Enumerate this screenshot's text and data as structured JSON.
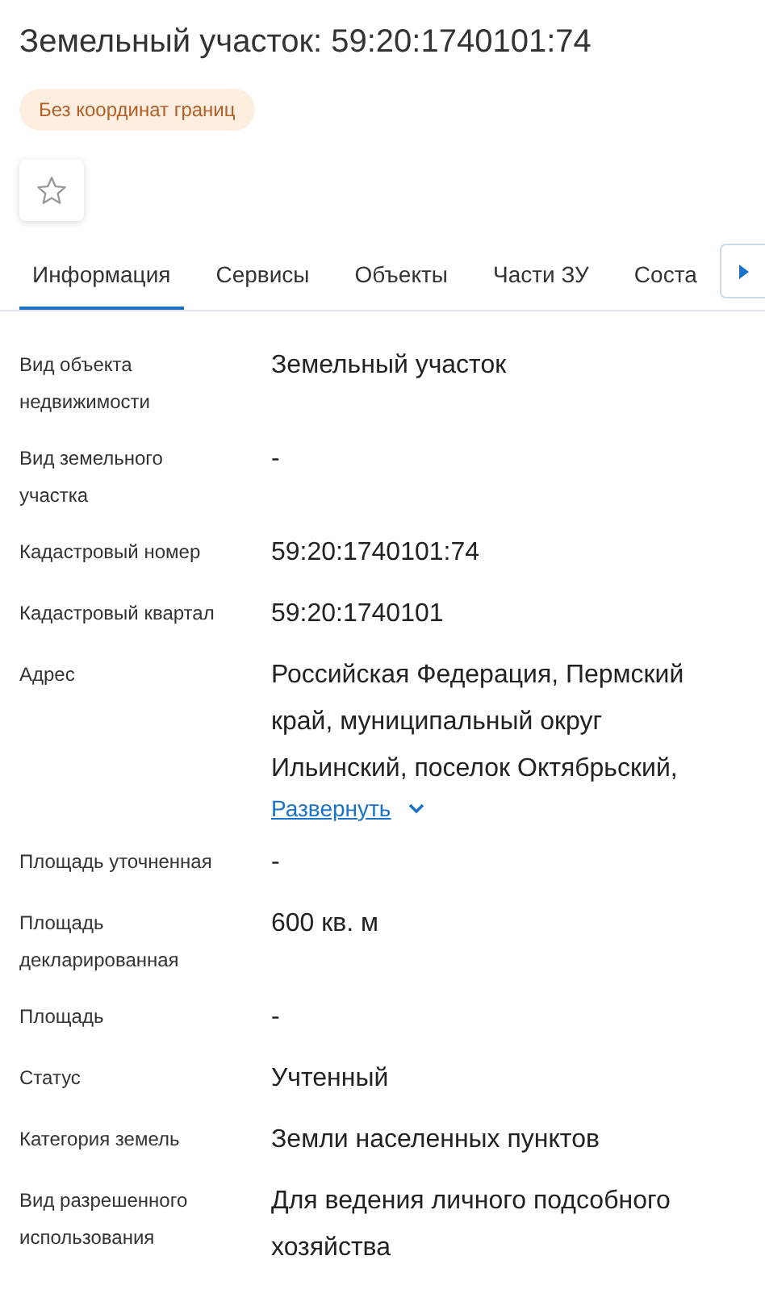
{
  "title": "Земельный участок: 59:20:1740101:74",
  "badge": "Без координат границ",
  "favorite": {
    "on": false
  },
  "tabs": [
    {
      "label": "Информация",
      "selected": true
    },
    {
      "label": "Сервисы",
      "selected": false
    },
    {
      "label": "Объекты",
      "selected": false
    },
    {
      "label": "Части ЗУ",
      "selected": false
    },
    {
      "label": "Соста",
      "selected": false
    }
  ],
  "fields": [
    {
      "label": "Вид объекта недвижимости",
      "value": "Земельный участок"
    },
    {
      "label": "Вид земельного участка",
      "value": "-"
    },
    {
      "label": "Кадастровый номер",
      "value": "59:20:1740101:74"
    },
    {
      "label": "Кадастровый квартал",
      "value": "59:20:1740101"
    },
    {
      "label": "Адрес",
      "value": "Российская Федерация, Пермский край, муниципальный округ Ильинский, поселок Октябрьский,",
      "expand_link": "Развернуть"
    },
    {
      "label": "Площадь уточненная",
      "value": "-"
    },
    {
      "label": "Площадь декларированная",
      "value": "600 кв. м"
    },
    {
      "label": "Площадь",
      "value": "-"
    },
    {
      "label": "Статус",
      "value": "Учтенный"
    },
    {
      "label": "Категория земель",
      "value": "Земли населенных пунктов"
    },
    {
      "label": "Вид разрешенного использования",
      "value": "Для ведения личного подсобного хозяйства"
    }
  ]
}
